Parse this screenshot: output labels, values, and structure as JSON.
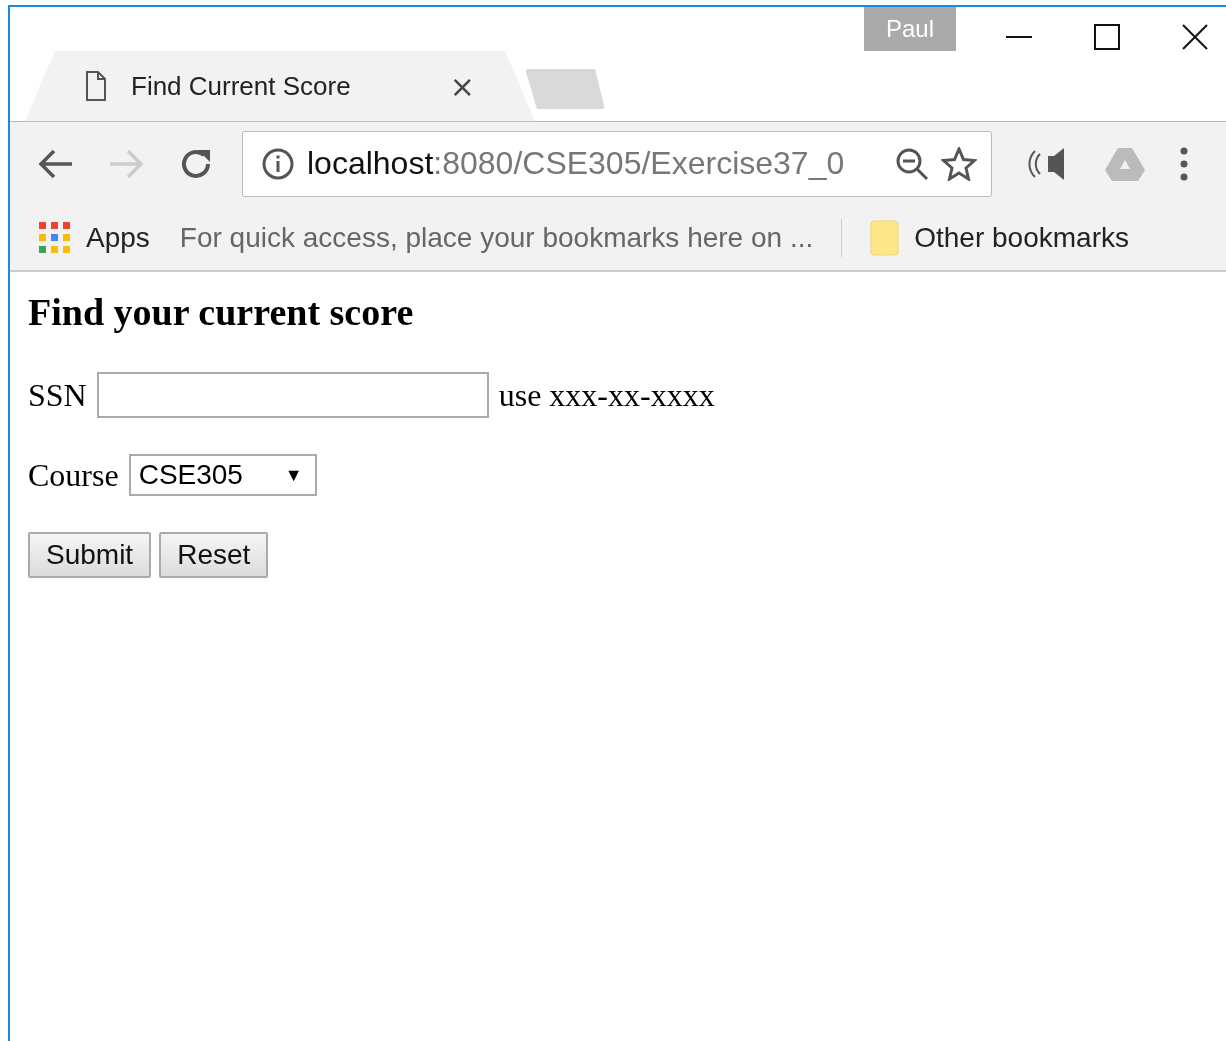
{
  "window": {
    "user": "Paul"
  },
  "tabs": [
    {
      "title": "Find Current Score",
      "close": "×",
      "selected": true
    }
  ],
  "address": {
    "host": "localhost",
    "path": ":8080/CSE305/Exercise37_0"
  },
  "bookmarks_bar": {
    "apps": "Apps",
    "hint": "For quick access, place your bookmarks here on ...",
    "other": "Other bookmarks"
  },
  "page": {
    "heading": "Find your current score",
    "ssn": {
      "label": "SSN",
      "hint": "use xxx-xx-xxxx"
    },
    "course": {
      "label": "Course",
      "value": "CSE305",
      "arrow": "▼"
    },
    "buttons": [
      "Submit",
      "Reset"
    ]
  }
}
